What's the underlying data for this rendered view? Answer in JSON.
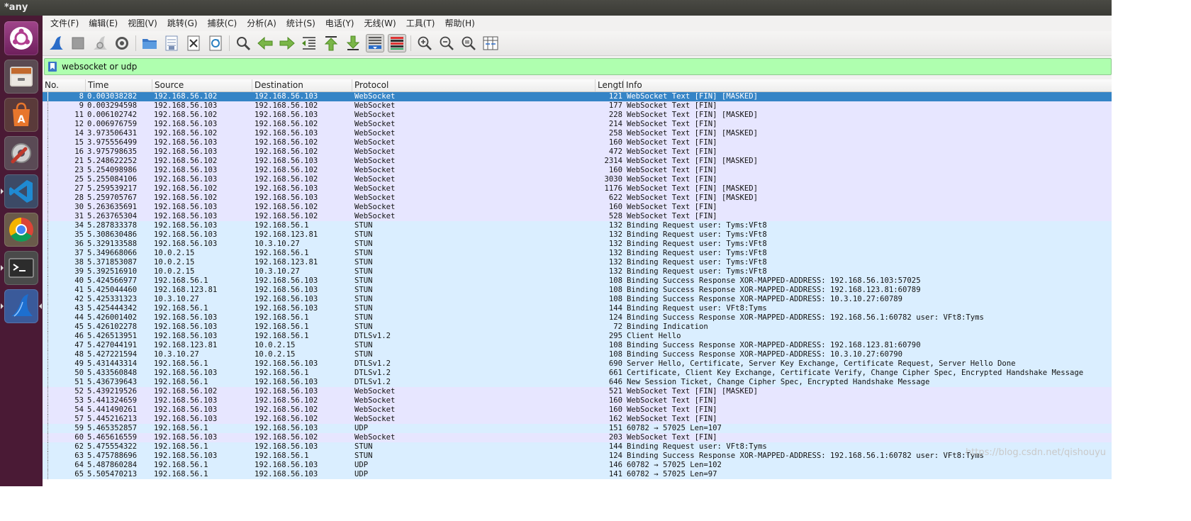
{
  "window": {
    "title": "*any"
  },
  "launcher": {
    "items": [
      {
        "name": "ubuntu-dash-icon"
      },
      {
        "name": "files-icon"
      },
      {
        "name": "software-center-icon"
      },
      {
        "name": "system-settings-icon"
      },
      {
        "name": "vscode-icon"
      },
      {
        "name": "chrome-icon"
      },
      {
        "name": "terminal-icon"
      },
      {
        "name": "wireshark-icon"
      }
    ]
  },
  "menu": [
    "文件(F)",
    "编辑(E)",
    "视图(V)",
    "跳转(G)",
    "捕获(C)",
    "分析(A)",
    "统计(S)",
    "电话(Y)",
    "无线(W)",
    "工具(T)",
    "帮助(H)"
  ],
  "toolbar": {
    "buttons": [
      "start-capture-icon",
      "stop-capture-icon",
      "restart-capture-icon",
      "capture-options-icon",
      "open-file-icon",
      "save-file-icon",
      "close-file-icon",
      "reload-file-icon",
      "find-packet-icon",
      "go-back-icon",
      "go-forward-icon",
      "go-to-packet-icon",
      "go-first-icon",
      "go-last-icon",
      "autoscroll-icon",
      "colorize-icon",
      "zoom-in-icon",
      "zoom-out-icon",
      "normal-size-icon",
      "resize-columns-icon"
    ]
  },
  "filter": {
    "value": "websocket or udp"
  },
  "columns": [
    "No.",
    "Time",
    "Source",
    "Destination",
    "Protocol",
    "Length",
    "Info"
  ],
  "colors": {
    "websocket_row": "#e7e6ff",
    "udp_row": "#daeeff",
    "selected_row": "#3584c6",
    "filter_bg": "#afffaf"
  },
  "packets": [
    {
      "no": "8",
      "time": "0.003038282",
      "src": "192.168.56.102",
      "dst": "192.168.56.103",
      "proto": "WebSocket",
      "len": "121",
      "info": "WebSocket Text [FIN] [MASKED]",
      "selected": true
    },
    {
      "no": "9",
      "time": "0.003294598",
      "src": "192.168.56.103",
      "dst": "192.168.56.102",
      "proto": "WebSocket",
      "len": "177",
      "info": "WebSocket Text [FIN]"
    },
    {
      "no": "11",
      "time": "0.006102742",
      "src": "192.168.56.102",
      "dst": "192.168.56.103",
      "proto": "WebSocket",
      "len": "228",
      "info": "WebSocket Text [FIN] [MASKED]"
    },
    {
      "no": "12",
      "time": "0.006976759",
      "src": "192.168.56.103",
      "dst": "192.168.56.102",
      "proto": "WebSocket",
      "len": "214",
      "info": "WebSocket Text [FIN]"
    },
    {
      "no": "14",
      "time": "3.973506431",
      "src": "192.168.56.102",
      "dst": "192.168.56.103",
      "proto": "WebSocket",
      "len": "258",
      "info": "WebSocket Text [FIN] [MASKED]"
    },
    {
      "no": "15",
      "time": "3.975556499",
      "src": "192.168.56.103",
      "dst": "192.168.56.102",
      "proto": "WebSocket",
      "len": "160",
      "info": "WebSocket Text [FIN]"
    },
    {
      "no": "16",
      "time": "3.975798635",
      "src": "192.168.56.103",
      "dst": "192.168.56.102",
      "proto": "WebSocket",
      "len": "472",
      "info": "WebSocket Text [FIN]"
    },
    {
      "no": "21",
      "time": "5.248622252",
      "src": "192.168.56.102",
      "dst": "192.168.56.103",
      "proto": "WebSocket",
      "len": "2314",
      "info": "WebSocket Text [FIN] [MASKED]"
    },
    {
      "no": "23",
      "time": "5.254098986",
      "src": "192.168.56.103",
      "dst": "192.168.56.102",
      "proto": "WebSocket",
      "len": "160",
      "info": "WebSocket Text [FIN]"
    },
    {
      "no": "25",
      "time": "5.255084106",
      "src": "192.168.56.103",
      "dst": "192.168.56.102",
      "proto": "WebSocket",
      "len": "3030",
      "info": "WebSocket Text [FIN]"
    },
    {
      "no": "27",
      "time": "5.259539217",
      "src": "192.168.56.102",
      "dst": "192.168.56.103",
      "proto": "WebSocket",
      "len": "1176",
      "info": "WebSocket Text [FIN] [MASKED]"
    },
    {
      "no": "28",
      "time": "5.259705767",
      "src": "192.168.56.102",
      "dst": "192.168.56.103",
      "proto": "WebSocket",
      "len": "622",
      "info": "WebSocket Text [FIN] [MASKED]"
    },
    {
      "no": "30",
      "time": "5.263635691",
      "src": "192.168.56.103",
      "dst": "192.168.56.102",
      "proto": "WebSocket",
      "len": "160",
      "info": "WebSocket Text [FIN]"
    },
    {
      "no": "31",
      "time": "5.263765304",
      "src": "192.168.56.103",
      "dst": "192.168.56.102",
      "proto": "WebSocket",
      "len": "528",
      "info": "WebSocket Text [FIN]"
    },
    {
      "no": "34",
      "time": "5.287833378",
      "src": "192.168.56.103",
      "dst": "192.168.56.1",
      "proto": "STUN",
      "len": "132",
      "info": "Binding Request user: Tyms:VFt8"
    },
    {
      "no": "35",
      "time": "5.308630486",
      "src": "192.168.56.103",
      "dst": "192.168.123.81",
      "proto": "STUN",
      "len": "132",
      "info": "Binding Request user: Tyms:VFt8"
    },
    {
      "no": "36",
      "time": "5.329133588",
      "src": "192.168.56.103",
      "dst": "10.3.10.27",
      "proto": "STUN",
      "len": "132",
      "info": "Binding Request user: Tyms:VFt8"
    },
    {
      "no": "37",
      "time": "5.349668066",
      "src": "10.0.2.15",
      "dst": "192.168.56.1",
      "proto": "STUN",
      "len": "132",
      "info": "Binding Request user: Tyms:VFt8"
    },
    {
      "no": "38",
      "time": "5.371853087",
      "src": "10.0.2.15",
      "dst": "192.168.123.81",
      "proto": "STUN",
      "len": "132",
      "info": "Binding Request user: Tyms:VFt8"
    },
    {
      "no": "39",
      "time": "5.392516910",
      "src": "10.0.2.15",
      "dst": "10.3.10.27",
      "proto": "STUN",
      "len": "132",
      "info": "Binding Request user: Tyms:VFt8"
    },
    {
      "no": "40",
      "time": "5.424566977",
      "src": "192.168.56.1",
      "dst": "192.168.56.103",
      "proto": "STUN",
      "len": "108",
      "info": "Binding Success Response XOR-MAPPED-ADDRESS: 192.168.56.103:57025"
    },
    {
      "no": "41",
      "time": "5.425044460",
      "src": "192.168.123.81",
      "dst": "192.168.56.103",
      "proto": "STUN",
      "len": "108",
      "info": "Binding Success Response XOR-MAPPED-ADDRESS: 192.168.123.81:60789"
    },
    {
      "no": "42",
      "time": "5.425331323",
      "src": "10.3.10.27",
      "dst": "192.168.56.103",
      "proto": "STUN",
      "len": "108",
      "info": "Binding Success Response XOR-MAPPED-ADDRESS: 10.3.10.27:60789"
    },
    {
      "no": "43",
      "time": "5.425444342",
      "src": "192.168.56.1",
      "dst": "192.168.56.103",
      "proto": "STUN",
      "len": "144",
      "info": "Binding Request user: VFt8:Tyms"
    },
    {
      "no": "44",
      "time": "5.426001402",
      "src": "192.168.56.103",
      "dst": "192.168.56.1",
      "proto": "STUN",
      "len": "124",
      "info": "Binding Success Response XOR-MAPPED-ADDRESS: 192.168.56.1:60782 user: VFt8:Tyms"
    },
    {
      "no": "45",
      "time": "5.426102278",
      "src": "192.168.56.103",
      "dst": "192.168.56.1",
      "proto": "STUN",
      "len": "72",
      "info": "Binding Indication"
    },
    {
      "no": "46",
      "time": "5.426513951",
      "src": "192.168.56.103",
      "dst": "192.168.56.1",
      "proto": "DTLSv1.2",
      "len": "295",
      "info": "Client Hello"
    },
    {
      "no": "47",
      "time": "5.427044191",
      "src": "192.168.123.81",
      "dst": "10.0.2.15",
      "proto": "STUN",
      "len": "108",
      "info": "Binding Success Response XOR-MAPPED-ADDRESS: 192.168.123.81:60790"
    },
    {
      "no": "48",
      "time": "5.427221594",
      "src": "10.3.10.27",
      "dst": "10.0.2.15",
      "proto": "STUN",
      "len": "108",
      "info": "Binding Success Response XOR-MAPPED-ADDRESS: 10.3.10.27:60790"
    },
    {
      "no": "49",
      "time": "5.431443314",
      "src": "192.168.56.1",
      "dst": "192.168.56.103",
      "proto": "DTLSv1.2",
      "len": "690",
      "info": "Server Hello, Certificate, Server Key Exchange, Certificate Request, Server Hello Done"
    },
    {
      "no": "50",
      "time": "5.433560848",
      "src": "192.168.56.103",
      "dst": "192.168.56.1",
      "proto": "DTLSv1.2",
      "len": "661",
      "info": "Certificate, Client Key Exchange, Certificate Verify, Change Cipher Spec, Encrypted Handshake Message"
    },
    {
      "no": "51",
      "time": "5.436739643",
      "src": "192.168.56.1",
      "dst": "192.168.56.103",
      "proto": "DTLSv1.2",
      "len": "646",
      "info": "New Session Ticket, Change Cipher Spec, Encrypted Handshake Message"
    },
    {
      "no": "52",
      "time": "5.439219526",
      "src": "192.168.56.102",
      "dst": "192.168.56.103",
      "proto": "WebSocket",
      "len": "521",
      "info": "WebSocket Text [FIN] [MASKED]"
    },
    {
      "no": "53",
      "time": "5.441324659",
      "src": "192.168.56.103",
      "dst": "192.168.56.102",
      "proto": "WebSocket",
      "len": "160",
      "info": "WebSocket Text [FIN]"
    },
    {
      "no": "54",
      "time": "5.441490261",
      "src": "192.168.56.103",
      "dst": "192.168.56.102",
      "proto": "WebSocket",
      "len": "160",
      "info": "WebSocket Text [FIN]"
    },
    {
      "no": "57",
      "time": "5.445216213",
      "src": "192.168.56.103",
      "dst": "192.168.56.102",
      "proto": "WebSocket",
      "len": "162",
      "info": "WebSocket Text [FIN]"
    },
    {
      "no": "59",
      "time": "5.465352857",
      "src": "192.168.56.1",
      "dst": "192.168.56.103",
      "proto": "UDP",
      "len": "151",
      "info": "60782 → 57025 Len=107"
    },
    {
      "no": "60",
      "time": "5.465616559",
      "src": "192.168.56.103",
      "dst": "192.168.56.102",
      "proto": "WebSocket",
      "len": "203",
      "info": "WebSocket Text [FIN]"
    },
    {
      "no": "62",
      "time": "5.475554322",
      "src": "192.168.56.1",
      "dst": "192.168.56.103",
      "proto": "STUN",
      "len": "144",
      "info": "Binding Request user: VFt8:Tyms"
    },
    {
      "no": "63",
      "time": "5.475788696",
      "src": "192.168.56.103",
      "dst": "192.168.56.1",
      "proto": "STUN",
      "len": "124",
      "info": "Binding Success Response XOR-MAPPED-ADDRESS: 192.168.56.1:60782 user: VFt8:Tyms"
    },
    {
      "no": "64",
      "time": "5.487860284",
      "src": "192.168.56.1",
      "dst": "192.168.56.103",
      "proto": "UDP",
      "len": "146",
      "info": "60782 → 57025 Len=102"
    },
    {
      "no": "65",
      "time": "5.505470213",
      "src": "192.168.56.1",
      "dst": "192.168.56.103",
      "proto": "UDP",
      "len": "141",
      "info": "60782 → 57025 Len=97"
    }
  ],
  "watermark": "https://blog.csdn.net/qishouyu"
}
